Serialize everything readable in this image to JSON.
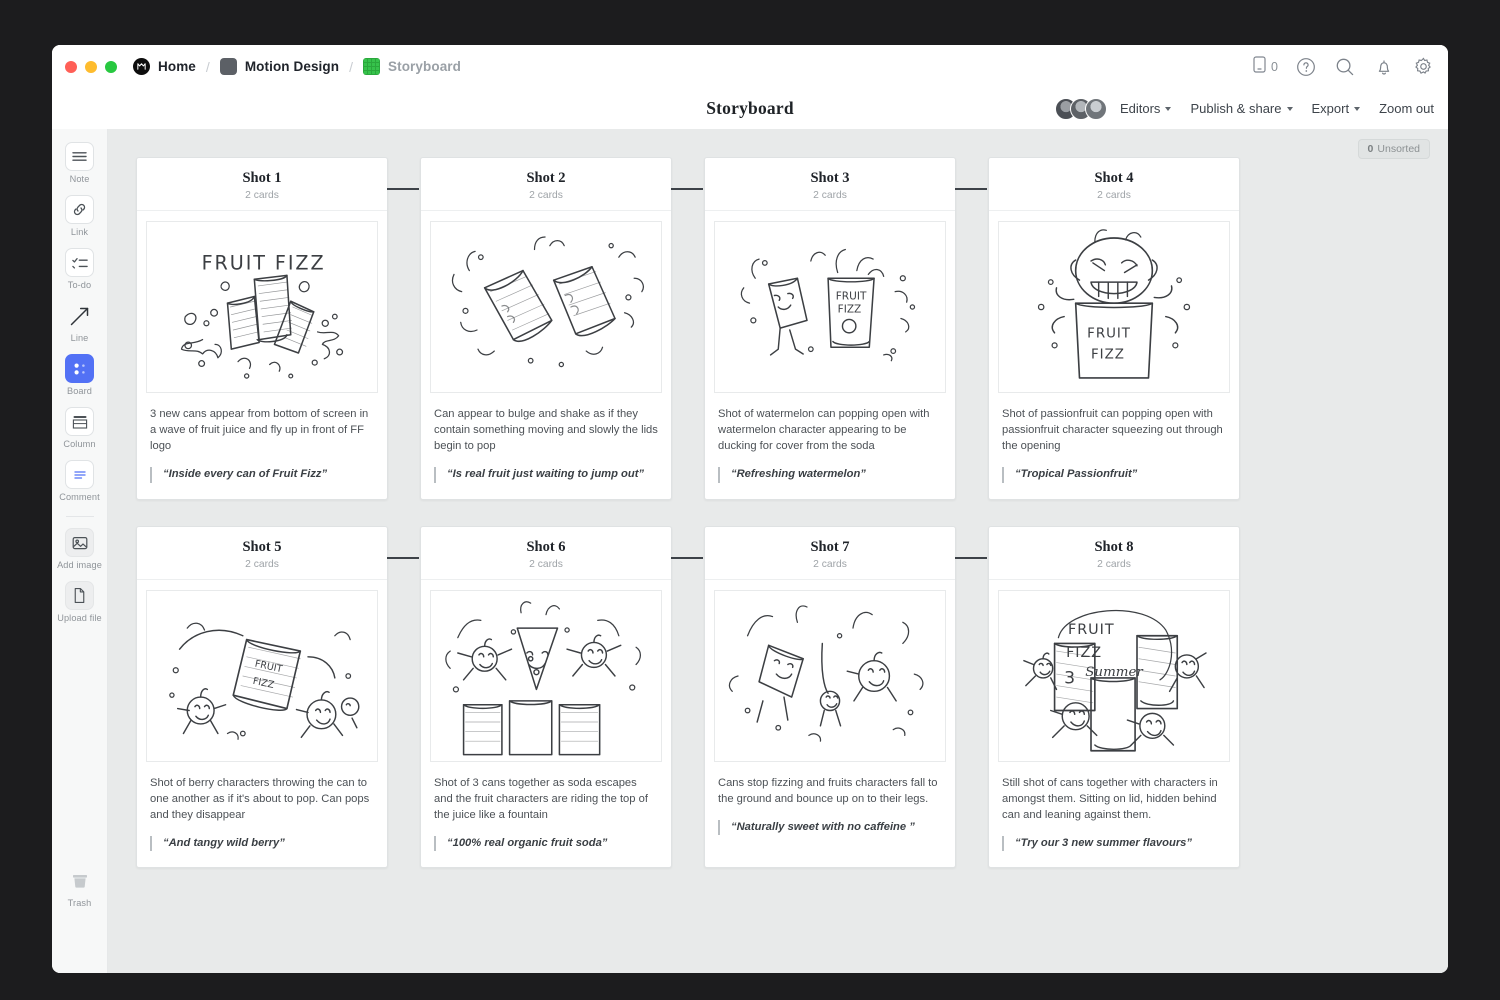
{
  "window": {
    "traffic_lights": [
      "close",
      "minimize",
      "maximize"
    ]
  },
  "breadcrumb": {
    "items": [
      {
        "label": "Home",
        "icon": "milanote-logo-icon",
        "active": true
      },
      {
        "label": "Motion Design",
        "icon": "folder-icon",
        "active": true
      },
      {
        "label": "Storyboard",
        "icon": "board-icon",
        "active": false
      }
    ],
    "separator": "/"
  },
  "topbar_icons": {
    "phone_count": "0",
    "phone": "mobile-icon",
    "help": "help-icon",
    "search": "search-icon",
    "notifications": "bell-icon",
    "settings": "gear-icon"
  },
  "header": {
    "title": "Storyboard",
    "editors_label": "Editors",
    "publish_label": "Publish & share",
    "export_label": "Export",
    "zoom_label": "Zoom out"
  },
  "sidebar": {
    "items": [
      {
        "label": "Note",
        "icon": "note-icon",
        "active": false
      },
      {
        "label": "Link",
        "icon": "link-icon",
        "active": false
      },
      {
        "label": "To-do",
        "icon": "todo-icon",
        "active": false
      },
      {
        "label": "Line",
        "icon": "line-arrow-icon",
        "active": false
      },
      {
        "label": "Board",
        "icon": "board-icon",
        "active": true
      },
      {
        "label": "Column",
        "icon": "column-icon",
        "active": false
      },
      {
        "label": "Comment",
        "icon": "comment-icon",
        "active": false
      },
      {
        "label": "Add image",
        "icon": "image-icon",
        "active": false
      },
      {
        "label": "Upload file",
        "icon": "file-icon",
        "active": false
      }
    ],
    "trash": {
      "label": "Trash",
      "icon": "trash-icon"
    }
  },
  "canvas": {
    "unsorted_count": "0",
    "unsorted_label": "Unsorted",
    "accent_color": "#5271f5",
    "background": "#e8eaea"
  },
  "cards": [
    {
      "title": "Shot 1",
      "subtitle": "2 cards",
      "description": "3 new cans appear from bottom of screen  in a wave of fruit juice and fly up in front of FF logo",
      "quote": "“Inside every can of Fruit Fizz”",
      "sketch": "three-cans-splash-fruit-fizz-logo"
    },
    {
      "title": "Shot 2",
      "subtitle": "2 cards",
      "description": "Can appear to bulge and shake as if they contain something moving and slowly the lids begin to pop",
      "quote": "“Is real fruit just waiting to jump out”",
      "sketch": "two-shaking-cans"
    },
    {
      "title": "Shot 3",
      "subtitle": "2 cards",
      "description": "Shot of watermelon can popping open with watermelon character appearing to be ducking for cover from the soda",
      "quote": "“Refreshing watermelon”",
      "sketch": "watermelon-character-and-can"
    },
    {
      "title": "Shot 4",
      "subtitle": "2 cards",
      "description": "Shot of passionfruit can popping open with passionfruit character squeezing out through the opening",
      "quote": "“Tropical Passionfruit”",
      "sketch": "passionfruit-squeezing-out-of-can"
    },
    {
      "title": "Shot 5",
      "subtitle": "2 cards",
      "description": "Shot of berry characters throwing the can to one another as if it's about to pop. Can pops and they disappear",
      "quote": "“And tangy wild berry”",
      "sketch": "berry-characters-throwing-can"
    },
    {
      "title": "Shot 6",
      "subtitle": "2 cards",
      "description": "Shot of 3 cans together as soda escapes and the fruit characters are riding the top of the juice like a fountain",
      "quote": "“100% real organic fruit soda”",
      "sketch": "three-cans-fountain-characters"
    },
    {
      "title": "Shot 7",
      "subtitle": "2 cards",
      "description": "Cans stop fizzing and fruits characters fall to the ground and bounce up on to their legs.",
      "quote": "“Naturally sweet with no caffeine ”",
      "sketch": "fruit-characters-falling"
    },
    {
      "title": "Shot 8",
      "subtitle": "2 cards",
      "description": "Still shot of cans together with characters in amongst them. Sitting on lid, hidden behind can and leaning against them.",
      "quote": "“Try our 3 new summer flavours”",
      "sketch": "final-group-shot-3-summer"
    }
  ]
}
